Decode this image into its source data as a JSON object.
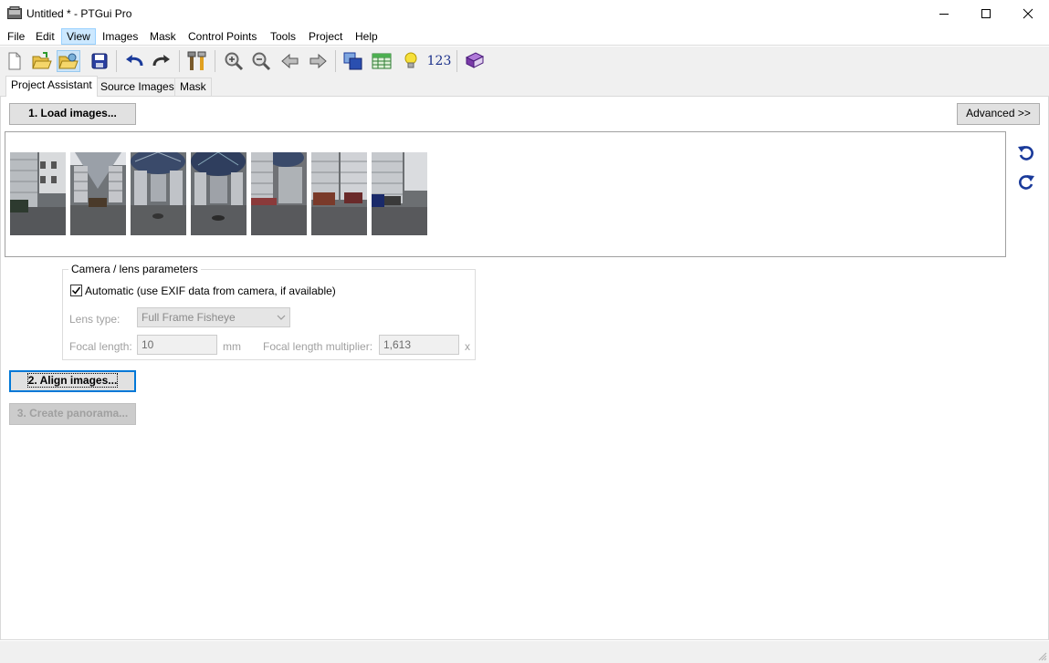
{
  "window": {
    "title": "Untitled * - PTGui Pro",
    "minimize_icon": "minimize-icon",
    "maximize_icon": "maximize-icon",
    "close_icon": "close-icon"
  },
  "menu": [
    "File",
    "Edit",
    "View",
    "Images",
    "Mask",
    "Control Points",
    "Tools",
    "Project",
    "Help"
  ],
  "toolbar": {
    "number_label": "123",
    "icons": [
      "new-icon",
      "open-icon",
      "open-pressed-icon",
      "save-icon",
      "undo-icon",
      "redo-icon",
      "tools-icon",
      "zoom-in-icon",
      "zoom-out-icon",
      "back-icon",
      "forward-icon",
      "panorama-editor-icon",
      "table-icon",
      "lightbulb-icon",
      "numbers-icon",
      "help-book-icon"
    ]
  },
  "tabs": [
    "Project Assistant",
    "Source Images",
    "Mask"
  ],
  "assistant": {
    "load_button": "1. Load images...",
    "advanced_button": "Advanced >>",
    "align_button": "2. Align images...",
    "create_button": "3. Create panorama..."
  },
  "camera": {
    "group_title": "Camera / lens parameters",
    "automatic_label": "Automatic (use EXIF data from camera, if available)",
    "automatic_checked": true,
    "lens_type_label": "Lens type:",
    "lens_type_value": "Full Frame Fisheye",
    "focal_length_label": "Focal length:",
    "focal_length_value": "10",
    "focal_unit": "mm",
    "multiplier_label": "Focal length multiplier:",
    "multiplier_value": "1,613",
    "multiplier_unit": "x"
  },
  "thumbnails": [
    {
      "name": "source-image-1"
    },
    {
      "name": "source-image-2"
    },
    {
      "name": "source-image-3"
    },
    {
      "name": "source-image-4"
    },
    {
      "name": "source-image-5"
    },
    {
      "name": "source-image-6"
    },
    {
      "name": "source-image-7"
    }
  ],
  "colors": {
    "accent": "#0078d7",
    "toolbar_bg": "#f0f0f0",
    "icon_blue": "#1a3a9a"
  }
}
